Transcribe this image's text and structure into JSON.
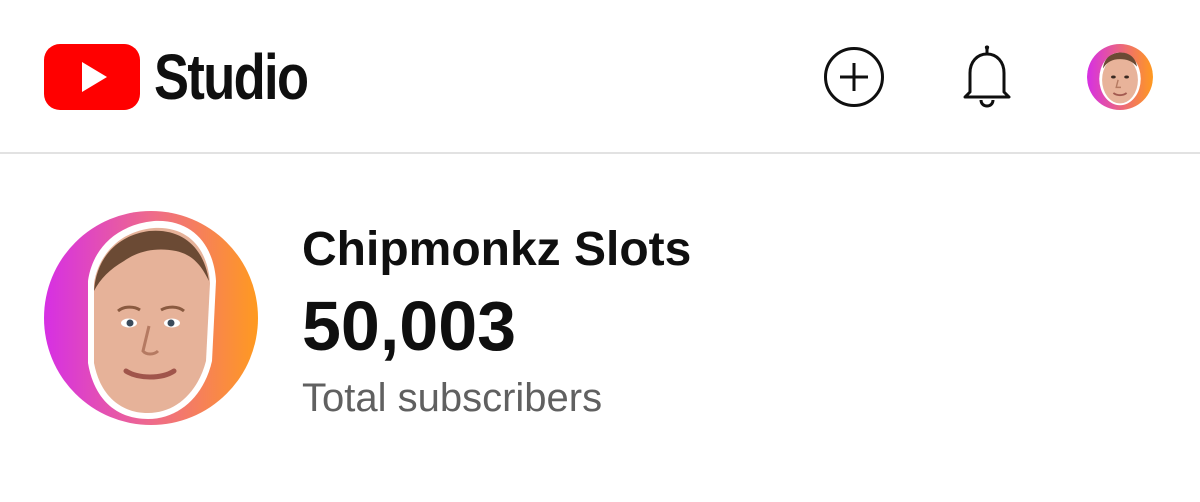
{
  "header": {
    "logo_text": "Studio",
    "logo_icon": "youtube-play-icon",
    "brand_color": "#ff0000",
    "actions": {
      "create_icon": "plus-circle-icon",
      "notifications_icon": "bell-icon",
      "account_icon": "avatar"
    }
  },
  "channel": {
    "name": "Chipmonkz Slots",
    "subscriber_count": "50,003",
    "subscriber_label": "Total subscribers",
    "avatar_ring_colors": [
      "#d62fe4",
      "#ff9a1f"
    ]
  }
}
